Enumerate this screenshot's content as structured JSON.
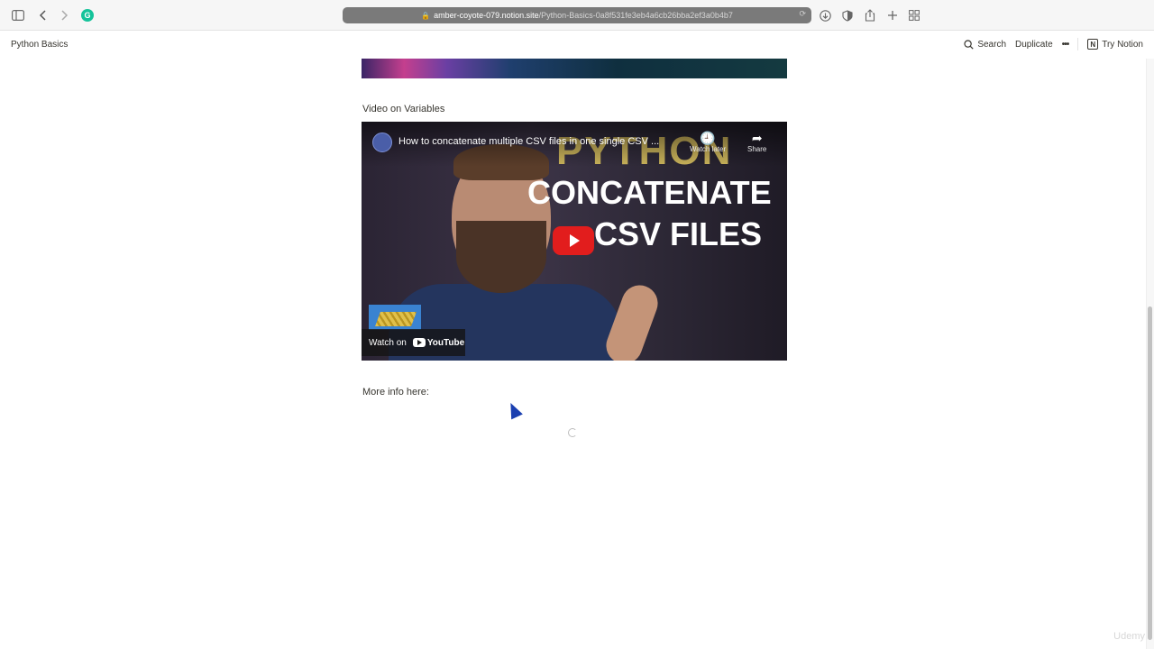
{
  "browser": {
    "url_host": "amber-coyote-079.notion.site",
    "url_path": "/Python-Basics-0a8f531fe3eb4a6cb26bba2ef3a0b4b7",
    "icons": [
      "sidebar-icon",
      "back-icon",
      "forward-icon",
      "grammarly-icon",
      "download-icon",
      "privacy-icon",
      "share-icon",
      "new-tab-icon",
      "tab-overview-icon"
    ]
  },
  "notion": {
    "page_title": "Python Basics",
    "search_label": "Search",
    "duplicate_label": "Duplicate",
    "more_label": "•••",
    "try_label": "Try Notion",
    "logo_letter": "N"
  },
  "content": {
    "video_section_label": "Video on Variables",
    "more_info_label": "More info here:"
  },
  "video": {
    "title": "How to concatenate multiple CSV files in one single CSV ...",
    "watch_later": "Watch later",
    "share": "Share",
    "thumb_line1": "PYTHON",
    "thumb_line2": "CONCATENATE",
    "thumb_line3": "CSV FILES",
    "watch_on": "Watch on",
    "youtube": "YouTube"
  },
  "watermark": "Udemy"
}
